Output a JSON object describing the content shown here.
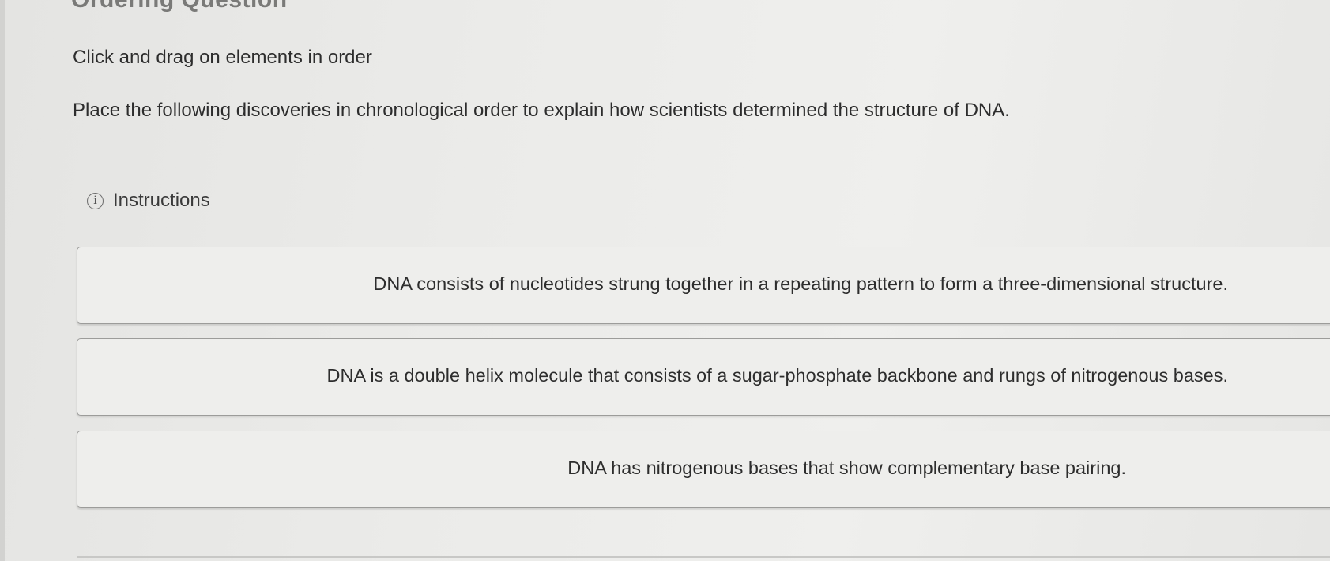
{
  "header": {
    "title": "Ordering Question"
  },
  "question": {
    "prompt_label": "Click and drag on elements in order",
    "text": "Place the following discoveries in chronological order to explain how scientists determined the structure of DNA."
  },
  "instructions": {
    "label": "Instructions",
    "icon": "info-icon",
    "icon_glyph": "i"
  },
  "items": [
    {
      "text": "DNA consists of nucleotides strung together in a repeating pattern to form a three-dimensional structure."
    },
    {
      "text": "DNA is a double helix molecule that consists of a sugar-phosphate backbone and rungs of nitrogenous bases."
    },
    {
      "text": "DNA has nitrogenous bases that show complementary base pairing."
    }
  ]
}
